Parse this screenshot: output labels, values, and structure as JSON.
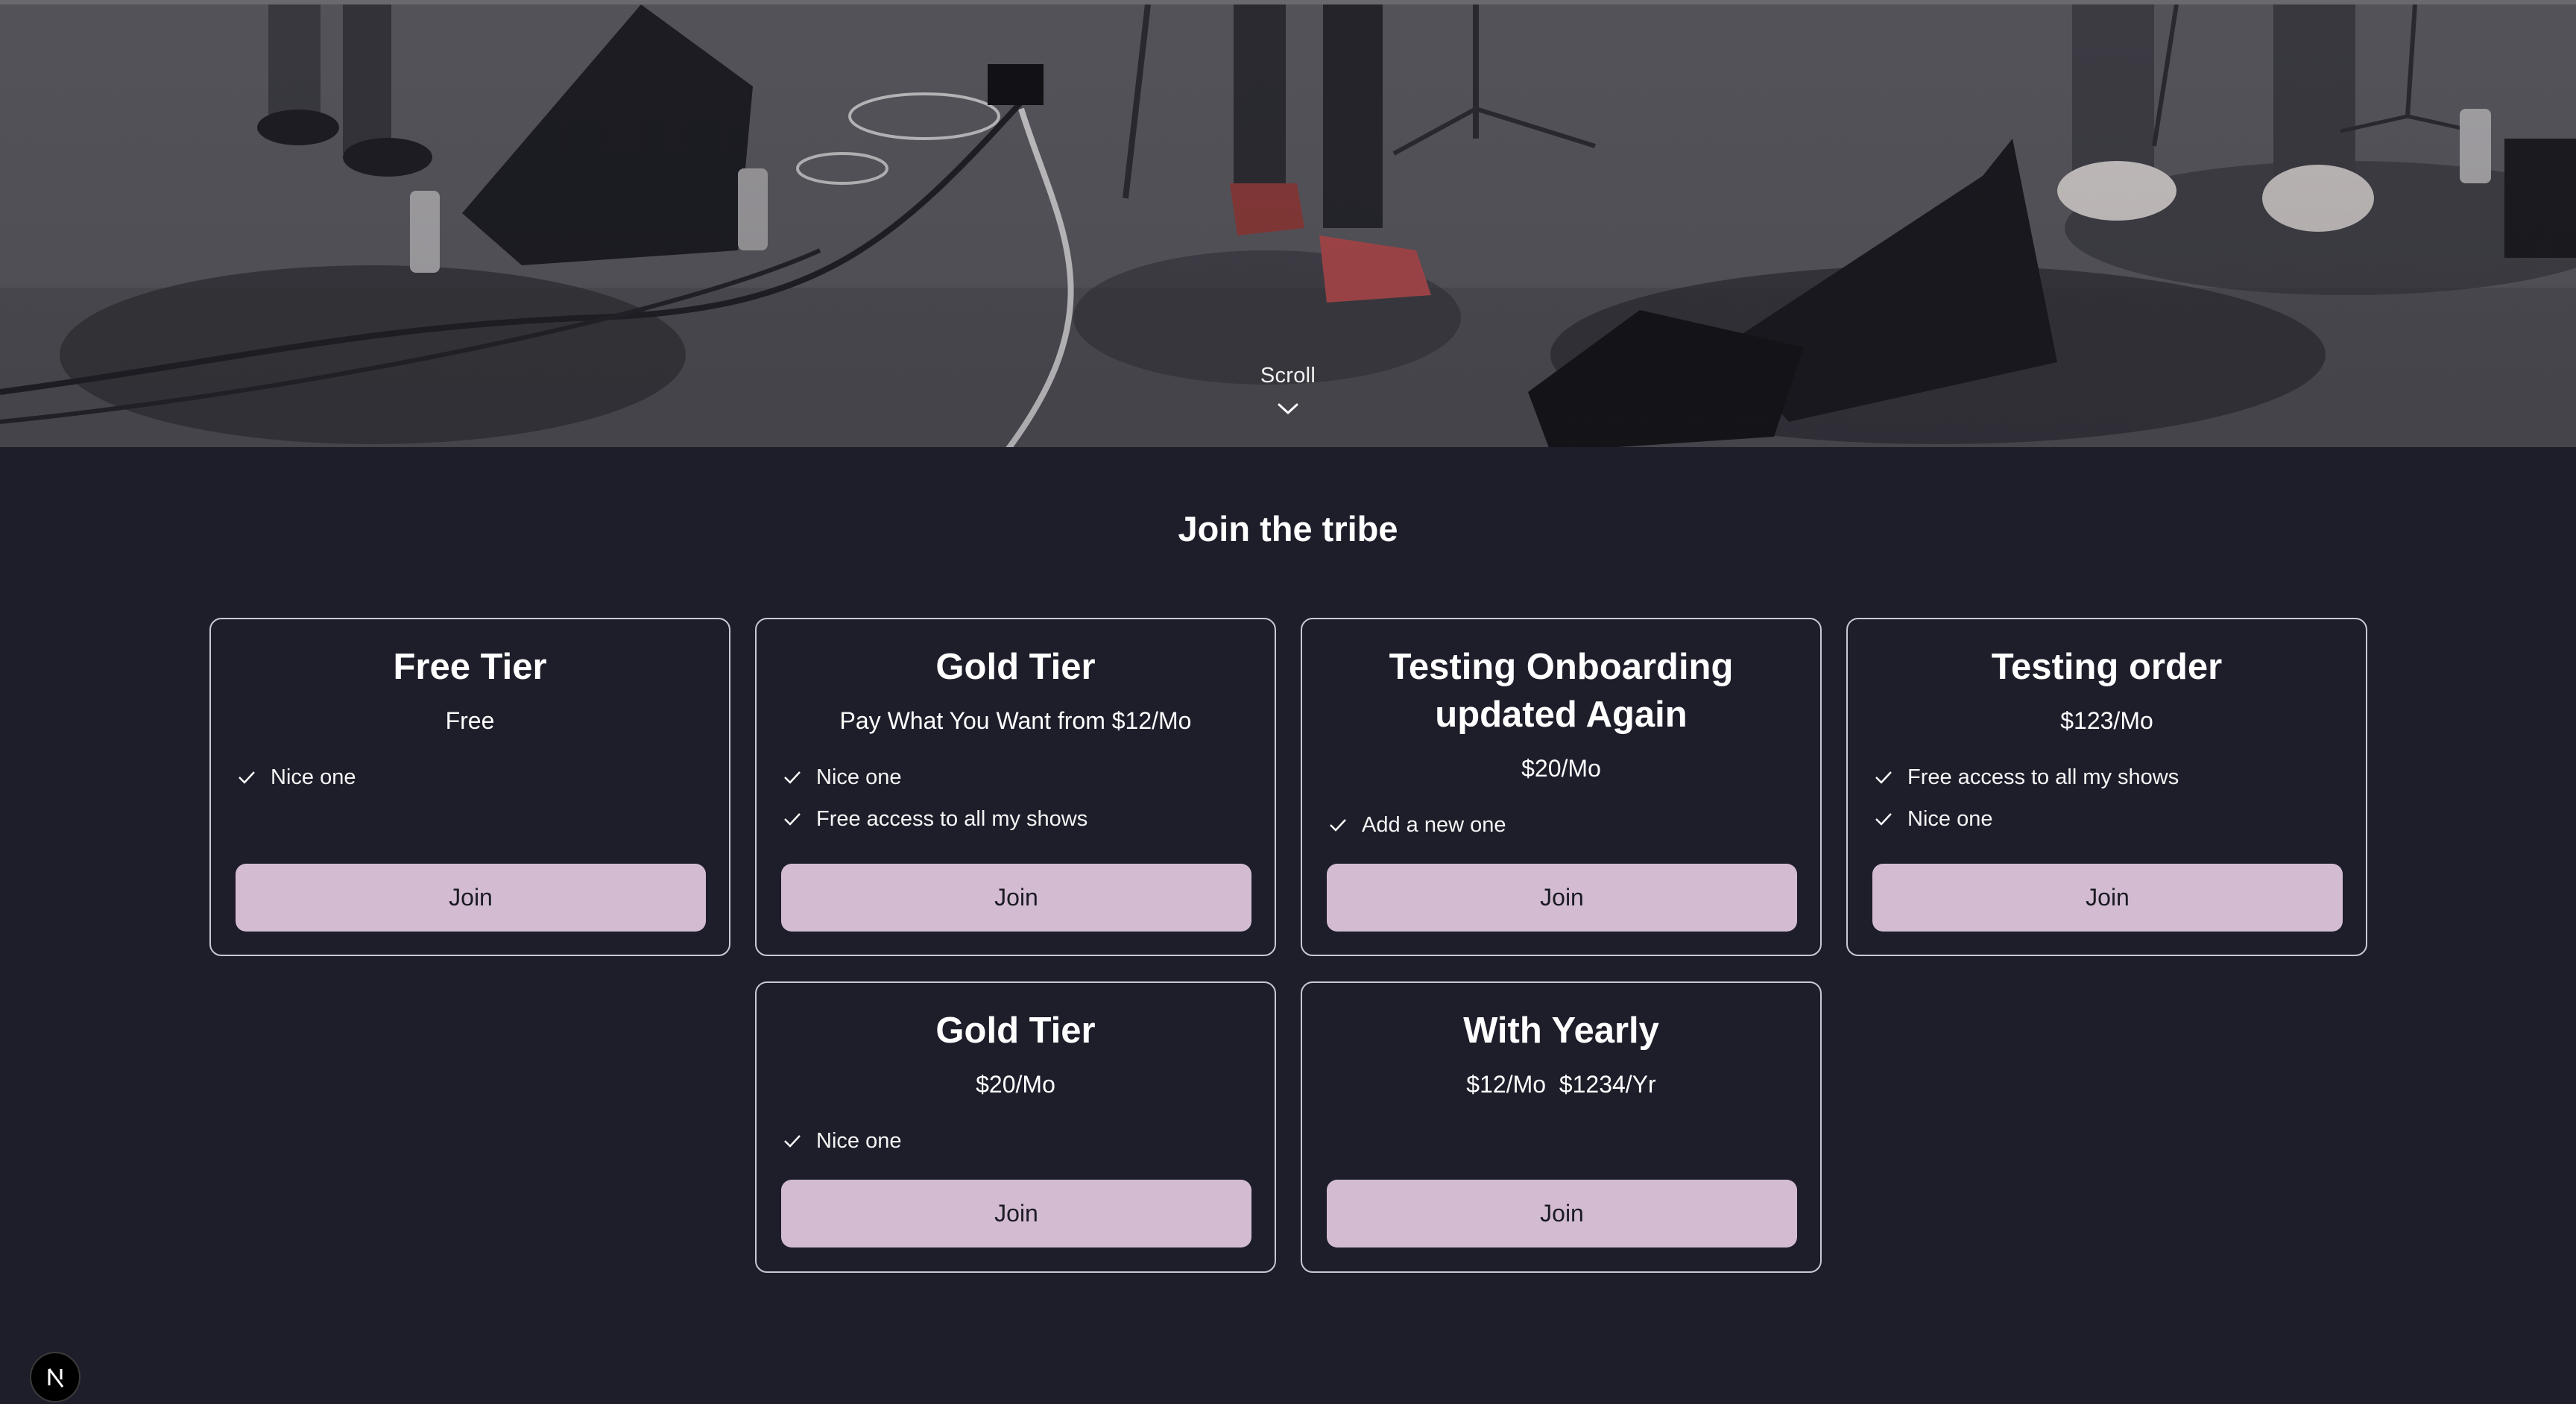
{
  "hero": {
    "scroll_label": "Scroll",
    "scroll_icon": "chevron-down-icon"
  },
  "section": {
    "title": "Join the tribe"
  },
  "tiers": [
    {
      "title": "Free Tier",
      "price": "Free",
      "features": [
        "Nice one"
      ],
      "button": "Join"
    },
    {
      "title": "Gold Tier",
      "price": "Pay What You Want from $12/Mo",
      "features": [
        "Nice one",
        "Free access to all my shows"
      ],
      "button": "Join"
    },
    {
      "title_line1": "Testing Onboarding",
      "title_line2": "updated Again",
      "price": "$20/Mo",
      "features": [
        "Add a new one"
      ],
      "button": "Join"
    },
    {
      "title": "Testing order",
      "price": "$123/Mo",
      "features": [
        "Free access to all my shows",
        "Nice one"
      ],
      "button": "Join"
    },
    {
      "title": "Gold Tier",
      "price": "$20/Mo",
      "features": [
        "Nice one"
      ],
      "button": "Join"
    },
    {
      "title": "With Yearly",
      "price": "$12/Mo  $1234/Yr",
      "features": [],
      "button": "Join"
    }
  ],
  "badge": {
    "letter": "N",
    "icon": "nextjs-logo-icon"
  },
  "colors": {
    "background": "#1e1e2b",
    "button": "#d3bcd1",
    "card_border": "#c9c9d2",
    "text": "#ffffff"
  }
}
